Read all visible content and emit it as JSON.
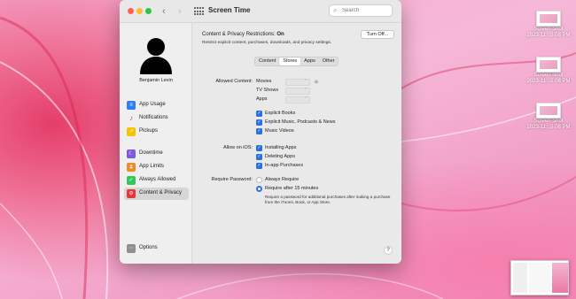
{
  "window": {
    "title": "Screen Time",
    "nav_back": "‹",
    "nav_forward": "›",
    "search_placeholder": "Search"
  },
  "sidebar": {
    "user_name": "Benjamin Levin",
    "items": [
      {
        "label": "App Usage",
        "icon": "layers-icon",
        "color": "#2f7cf6"
      },
      {
        "label": "Notifications",
        "icon": "bell-icon",
        "color": "#e5383b"
      },
      {
        "label": "Pickups",
        "icon": "pickups-icon",
        "color": "#f5c400"
      },
      {
        "label": "Downtime",
        "icon": "moon-icon",
        "color": "#7d5be0"
      },
      {
        "label": "App Limits",
        "icon": "hourglass-icon",
        "color": "#f08a24"
      },
      {
        "label": "Always Allowed",
        "icon": "checkmark-icon",
        "color": "#34c759"
      },
      {
        "label": "Content & Privacy",
        "icon": "no-entry-icon",
        "color": "#e5383b"
      }
    ],
    "active_index": 6,
    "options_label": "Options"
  },
  "main": {
    "restrictions_label": "Content & Privacy Restrictions:",
    "restrictions_state": "On",
    "restrictions_desc": "Restrict explicit content, purchases, downloads, and privacy settings.",
    "turn_off_label": "Turn Off...",
    "tabs": [
      "Content",
      "Stores",
      "Apps",
      "Other"
    ],
    "active_tab": "Stores",
    "allowed_content_label": "Allowed Content:",
    "allowed_content_fields": [
      "Movies",
      "TV Shows",
      "Apps"
    ],
    "explicit_checks": [
      "Explicit Books",
      "Explicit Music, Podcasts & News",
      "Music Videos"
    ],
    "allow_ios_label": "Allow on iOS:",
    "ios_checks": [
      "Installing Apps",
      "Deleting Apps",
      "In-app Purchases"
    ],
    "require_password_label": "Require Password:",
    "password_options": [
      "Always Require",
      "Require after 15 minutes"
    ],
    "password_selected": 1,
    "password_note": "Require a password for additional purchases after making a purchase from the iTunes, Book, or App Store.",
    "help_label": "?"
  },
  "desktop": {
    "files": [
      {
        "name": "Screen Shot",
        "date": "2023-11...5.08 PM"
      },
      {
        "name": "Screen Shot",
        "date": "2023-11...5.08 PM"
      },
      {
        "name": "Screen Shot",
        "date": "2023-11...5.08 PM"
      }
    ]
  },
  "colors": {
    "accent": "#2b6fe3",
    "close": "#fe5f57",
    "minimize": "#febc2e",
    "maximize": "#28c840"
  }
}
